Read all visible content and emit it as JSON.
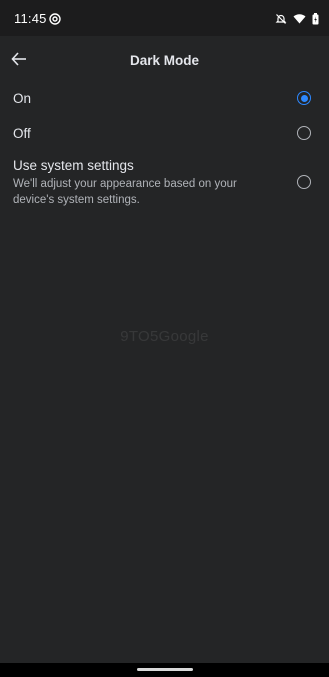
{
  "status_bar": {
    "time": "11:45",
    "left_icon": "at-sign-icon",
    "right_icons": [
      "notifications-off-icon",
      "wifi-icon",
      "battery-icon"
    ]
  },
  "header": {
    "title": "Dark Mode",
    "back_icon": "arrow-left-icon"
  },
  "options": [
    {
      "label": "On",
      "selected": true
    },
    {
      "label": "Off",
      "selected": false
    },
    {
      "label": "Use system settings",
      "description": "We'll adjust your appearance based on your device's system settings.",
      "selected": false
    }
  ],
  "watermark": "9TO5Google",
  "colors": {
    "background": "#242526",
    "accent": "#2d88ff",
    "text": "#e4e6eb",
    "secondary_text": "#b0b3b8"
  }
}
